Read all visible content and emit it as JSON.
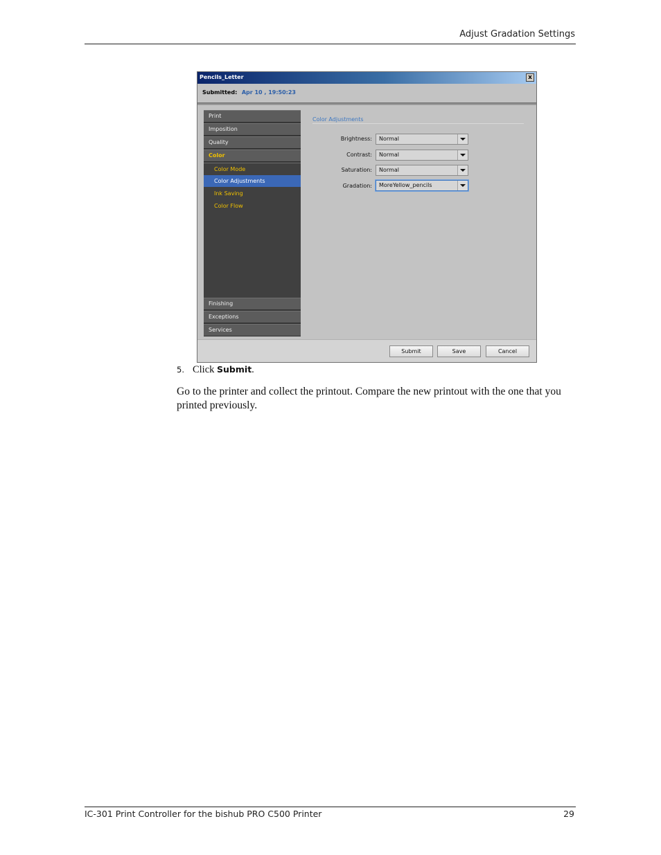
{
  "header": {
    "section_title": "Adjust Gradation Settings"
  },
  "dialog": {
    "title": "Pencils_Letter",
    "close_glyph": "x",
    "submitted_label": "Submitted:",
    "submitted_value": "Apr 10 , 19:50:23",
    "nav": {
      "print": "Print",
      "imposition": "Imposition",
      "quality": "Quality",
      "color": "Color",
      "color_mode": "Color Mode",
      "color_adjustments": "Color Adjustments",
      "ink_saving": "Ink Saving",
      "color_flow": "Color Flow",
      "finishing": "Finishing",
      "exceptions": "Exceptions",
      "services": "Services"
    },
    "panel_title": "Color Adjustments",
    "fields": {
      "brightness": {
        "label": "Brightness:",
        "value": "Normal"
      },
      "contrast": {
        "label": "Contrast:",
        "value": "Normal"
      },
      "saturation": {
        "label": "Saturation:",
        "value": "Normal"
      },
      "gradation": {
        "label": "Gradation:",
        "value": "MoreYellow_pencils"
      }
    },
    "buttons": {
      "submit": "Submit",
      "save": "Save",
      "cancel": "Cancel"
    }
  },
  "body": {
    "step_number": "5.",
    "step_text": "Click",
    "step_command": "Submit",
    "step_end": ".",
    "paragraph": "Go to the printer and collect the printout. Compare the new printout with the one that you printed previously."
  },
  "footer": {
    "product": "IC-301 Print Controller for the bishub PRO C500 Printer",
    "page_number": "29"
  },
  "colors": {
    "sidebar_bg": "#404040",
    "active_yellow": "#f0c000",
    "selected_blue": "#3b68b7",
    "accent_blue": "#3e78c2"
  }
}
